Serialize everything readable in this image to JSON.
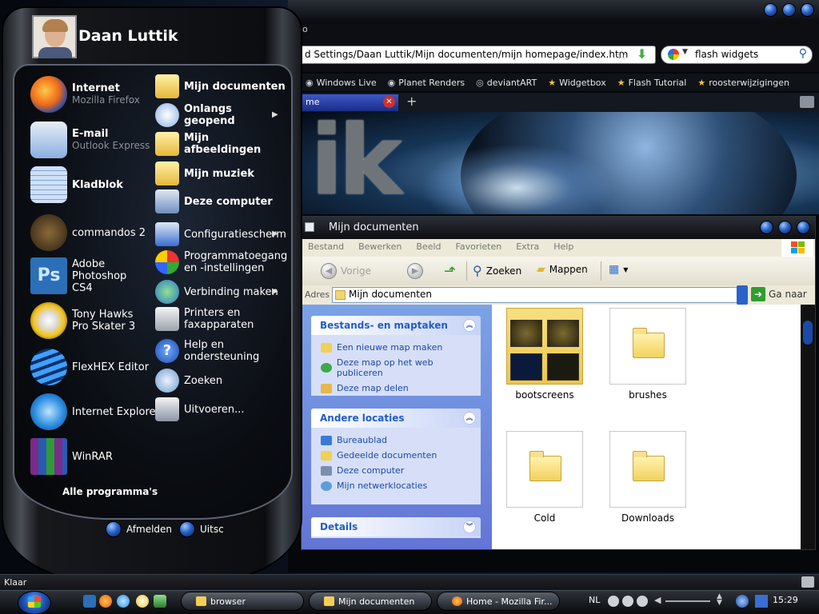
{
  "firefox": {
    "url": "d Settings/Daan Luttik/Mijn documenten/mijn homepage/index.htm",
    "search_value": "flash widgets",
    "top_left_text": "o",
    "bookmarks": [
      "Windows Live",
      "Planet Renders",
      "deviantART",
      "Widgetbox",
      "Flash Tutorial",
      "roosterwijzigingen"
    ],
    "tab_label": "me",
    "tab_close": "✕",
    "tab_new": "+",
    "page_heading": "ik"
  },
  "explorer": {
    "title": "Mijn documenten",
    "menu": [
      "Bestand",
      "Bewerken",
      "Beeld",
      "Favorieten",
      "Extra",
      "Help"
    ],
    "toolbar": {
      "back": "Vorige",
      "search": "Zoeken",
      "folders": "Mappen"
    },
    "address_label": "Adres",
    "address_value": "Mijn documenten",
    "go_label": "Ga naar",
    "tasks_panel": {
      "title": "Bestands- en maptaken",
      "items": [
        "Een nieuwe map maken",
        "Deze map op het web publiceren",
        "Deze map delen"
      ]
    },
    "places_panel": {
      "title": "Andere locaties",
      "items": [
        "Bureaublad",
        "Gedeelde documenten",
        "Deze computer",
        "Mijn netwerklocaties"
      ]
    },
    "details_panel": {
      "title": "Details"
    },
    "folders": [
      "bootscreens",
      "brushes",
      "Cold",
      "Downloads"
    ]
  },
  "startmenu": {
    "username": "Daan Luttik",
    "left_items": [
      {
        "label": "Internet",
        "sub": "Mozilla Firefox"
      },
      {
        "label": "E-mail",
        "sub": "Outlook Express"
      },
      {
        "label": "Kladblok",
        "sub": ""
      },
      {
        "label": "commandos 2",
        "sub": ""
      },
      {
        "label": "Adobe Photoshop CS4",
        "sub": ""
      },
      {
        "label": "Tony Hawks Pro Skater 3",
        "sub": ""
      },
      {
        "label": "FlexHEX Editor",
        "sub": ""
      },
      {
        "label": "Internet Explorer",
        "sub": ""
      },
      {
        "label": "WinRAR",
        "sub": ""
      }
    ],
    "right_items": [
      "Mijn documenten",
      "Onlangs geopend",
      "Mijn afbeeldingen",
      "Mijn muziek",
      "Deze computer",
      "Configuratiescherm",
      "Programmatoegang en -instellingen",
      "Verbinding maken",
      "Printers en faxapparaten",
      "Help en ondersteuning",
      "Zoeken",
      "Uitvoeren..."
    ],
    "all_programs": "Alle programma's",
    "logoff": "Afmelden",
    "shutdown": "Uitsc"
  },
  "statusbar": {
    "text": "Klaar"
  },
  "taskbar": {
    "buttons": [
      "browser",
      "Mijn documenten",
      "Home - Mozilla Fir..."
    ],
    "language": "NL",
    "clock": "15:29"
  },
  "colors": {
    "xp_blue": "#215dc6",
    "orb_blue": "#2b63c9",
    "panel_bg": "#d6dff7"
  }
}
